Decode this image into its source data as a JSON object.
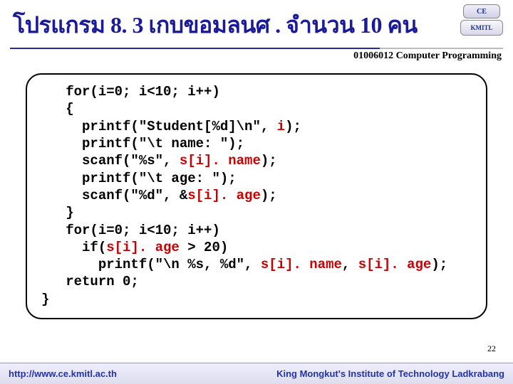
{
  "header": {
    "title": "โปรแกรม  8. 3 เกบขอมลนศ  . จำนวน  10 คน",
    "course": "01006012 Computer Programming",
    "logo_top": "CE",
    "logo_bot": "KMITL"
  },
  "code": {
    "l1a": "   for(i=0; i<10; i++)",
    "l2": "   {",
    "l3a": "     printf(\"Student[%d]\\n\", ",
    "l3b": "i",
    "l3c": ");",
    "l4": "     printf(\"\\t name: \");",
    "l5a": "     scanf(\"%s\", ",
    "l5b": "s[i]. name",
    "l5c": ");",
    "l6": "     printf(\"\\t age: \");",
    "l7a": "     scanf(\"%d\", &",
    "l7b": "s[i]. age",
    "l7c": ");",
    "l8": "   }",
    "l9": "   for(i=0; i<10; i++)",
    "l10a": "     if(",
    "l10b": "s[i]. age",
    "l10c": " > 20)",
    "l11a": "       printf(\"\\n %s, %d\", ",
    "l11b": "s[i]. name",
    "l11c": ", ",
    "l11d": "s[i]. age",
    "l11e": ");",
    "l12": "   return 0;",
    "l13": "}"
  },
  "page_number": "22",
  "footer": {
    "url": "http://www.ce.kmitl.ac.th",
    "institution": "King Mongkut's Institute of Technology Ladkrabang"
  }
}
